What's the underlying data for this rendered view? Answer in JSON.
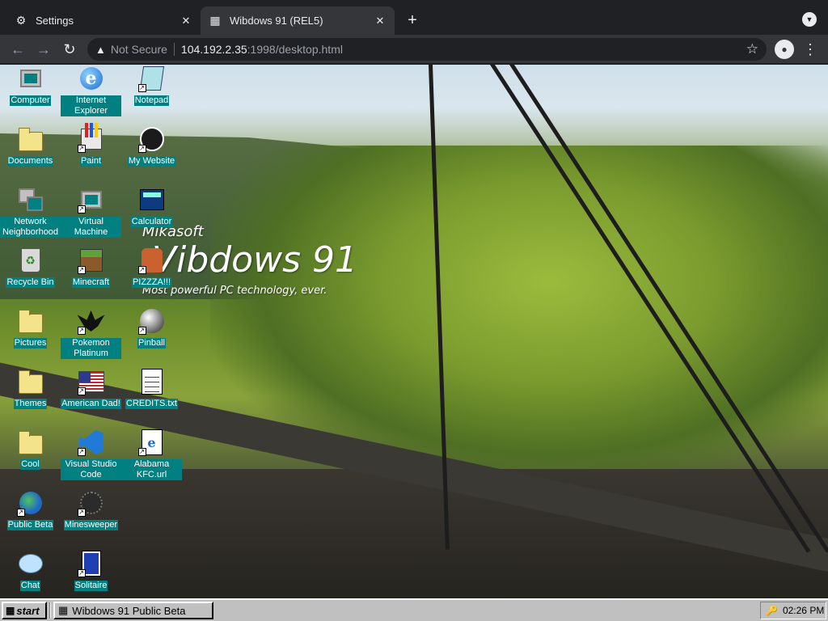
{
  "browser": {
    "tabs": [
      {
        "label": "Settings",
        "icon": "gear-icon",
        "active": false
      },
      {
        "label": "Wibdows 91 (REL5)",
        "icon": "wibdows-favicon",
        "active": true
      }
    ],
    "new_tab_symbol": "+",
    "address": {
      "security_label": "Not Secure",
      "host": "104.192.2.35",
      "rest": ":1998/desktop.html"
    }
  },
  "desktop": {
    "logo": {
      "maker": "Mikasoft",
      "product": "Vibdows 91",
      "slogan": "Most powerful PC technology, ever."
    },
    "icons": [
      {
        "label": "Computer",
        "icon": "computer-icon"
      },
      {
        "label": "Internet Explorer",
        "icon": "internet-explorer-icon"
      },
      {
        "label": "Notepad",
        "icon": "notepad-icon"
      },
      {
        "label": "Documents",
        "icon": "folder-icon"
      },
      {
        "label": "Paint",
        "icon": "paint-icon"
      },
      {
        "label": "My Website",
        "icon": "github-icon"
      },
      {
        "label": "Network Neighborhood",
        "icon": "network-icon"
      },
      {
        "label": "Virtual Machine",
        "icon": "computer-icon"
      },
      {
        "label": "Calculator",
        "icon": "calculator-icon"
      },
      {
        "label": "Recycle Bin",
        "icon": "recycle-bin-icon"
      },
      {
        "label": "Minecraft",
        "icon": "minecraft-icon"
      },
      {
        "label": "PIZZZA!!!",
        "icon": "chair-icon"
      },
      {
        "label": "Pictures",
        "icon": "folder-icon"
      },
      {
        "label": "Pokemon Platinum",
        "icon": "pokemon-icon"
      },
      {
        "label": "Pinball",
        "icon": "pinball-icon"
      },
      {
        "label": "Themes",
        "icon": "folder-icon"
      },
      {
        "label": "American Dad!",
        "icon": "us-flag-icon"
      },
      {
        "label": "CREDITS.txt",
        "icon": "text-document-icon"
      },
      {
        "label": "Cool",
        "icon": "folder-icon"
      },
      {
        "label": "Visual Studio Code",
        "icon": "vscode-icon"
      },
      {
        "label": "Alabama KFC.url",
        "icon": "internet-shortcut-icon"
      },
      {
        "label": "Public Beta",
        "icon": "globe-icon"
      },
      {
        "label": "Minesweeper",
        "icon": "mine-icon"
      },
      {
        "label": "Chat",
        "icon": "chat-bubble-icon"
      },
      {
        "label": "Solitaire",
        "icon": "cards-icon"
      }
    ]
  },
  "taskbar": {
    "start_label": "start",
    "window_label": "Wibdows 91 Public Beta",
    "clock": "02:26 PM"
  },
  "colors": {
    "label_bg": "#008080",
    "taskbar_bg": "#c0c0c0",
    "chrome_dark": "#202124",
    "chrome_toolbar": "#35363a"
  }
}
